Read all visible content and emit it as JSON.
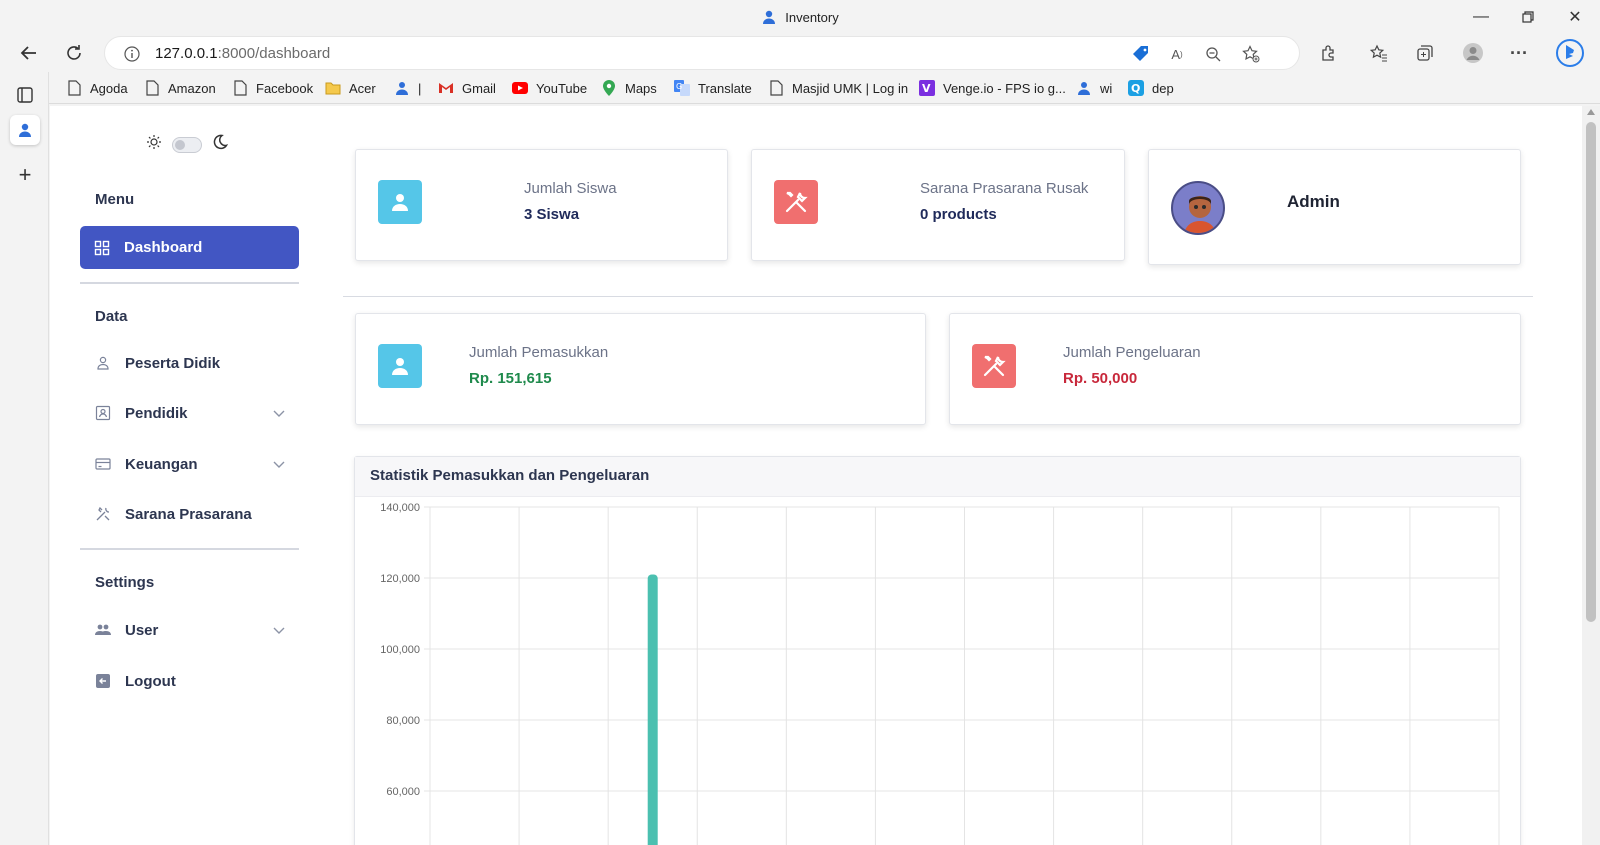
{
  "browser": {
    "window_title": "Inventory",
    "url_host": "127.0.0.1",
    "url_path": ":8000/dashboard",
    "bookmarks": [
      "Agoda",
      "Amazon",
      "Facebook",
      "Acer",
      "|",
      "Gmail",
      "YouTube",
      "Maps",
      "Translate",
      "Masjid UMK | Log in",
      "Venge.io - FPS io g...",
      "wi",
      "dep"
    ]
  },
  "sidebar": {
    "menu_title": "Menu",
    "dashboard_label": "Dashboard",
    "data_title": "Data",
    "items": [
      {
        "label": "Peserta Didik",
        "icon": "user-icon"
      },
      {
        "label": "Pendidik",
        "icon": "id-card-icon"
      },
      {
        "label": "Keuangan",
        "icon": "credit-card-icon"
      },
      {
        "label": "Sarana Prasarana",
        "icon": "tools-icon"
      }
    ],
    "settings_title": "Settings",
    "user_label": "User",
    "logout_label": "Logout"
  },
  "cards": {
    "siswa_label": "Jumlah Siswa",
    "siswa_value": "3 Siswa",
    "rusak_label": "Sarana Prasarana Rusak",
    "rusak_value": "0 products",
    "admin_label": "Admin",
    "pemasukkan_label": "Jumlah Pemasukkan",
    "pemasukkan_value": "Rp. 151,615",
    "pengeluaran_label": "Jumlah Pengeluaran",
    "pengeluaran_value": "Rp. 50,000"
  },
  "colors": {
    "accent": "#4256c3",
    "tile_blue": "#55c6e8",
    "tile_red": "#f06f6f",
    "income_green": "#1f8a4c",
    "expense_red": "#c8283b",
    "bar_teal": "#4bc0b0"
  },
  "chart_data": {
    "type": "bar",
    "title": "Statistik Pemasukkan dan Pengeluaran",
    "xlabel": "",
    "ylabel": "",
    "ylim": [
      40000,
      140000
    ],
    "yticks": [
      "140,000",
      "120,000",
      "100,000",
      "80,000",
      "60,000"
    ],
    "grid": true,
    "category_count": 12,
    "series": [
      {
        "values": [
          null,
          null,
          121000,
          null,
          null,
          null,
          null,
          null,
          null,
          null,
          null,
          null
        ],
        "color": "#4bc0b0"
      }
    ]
  }
}
